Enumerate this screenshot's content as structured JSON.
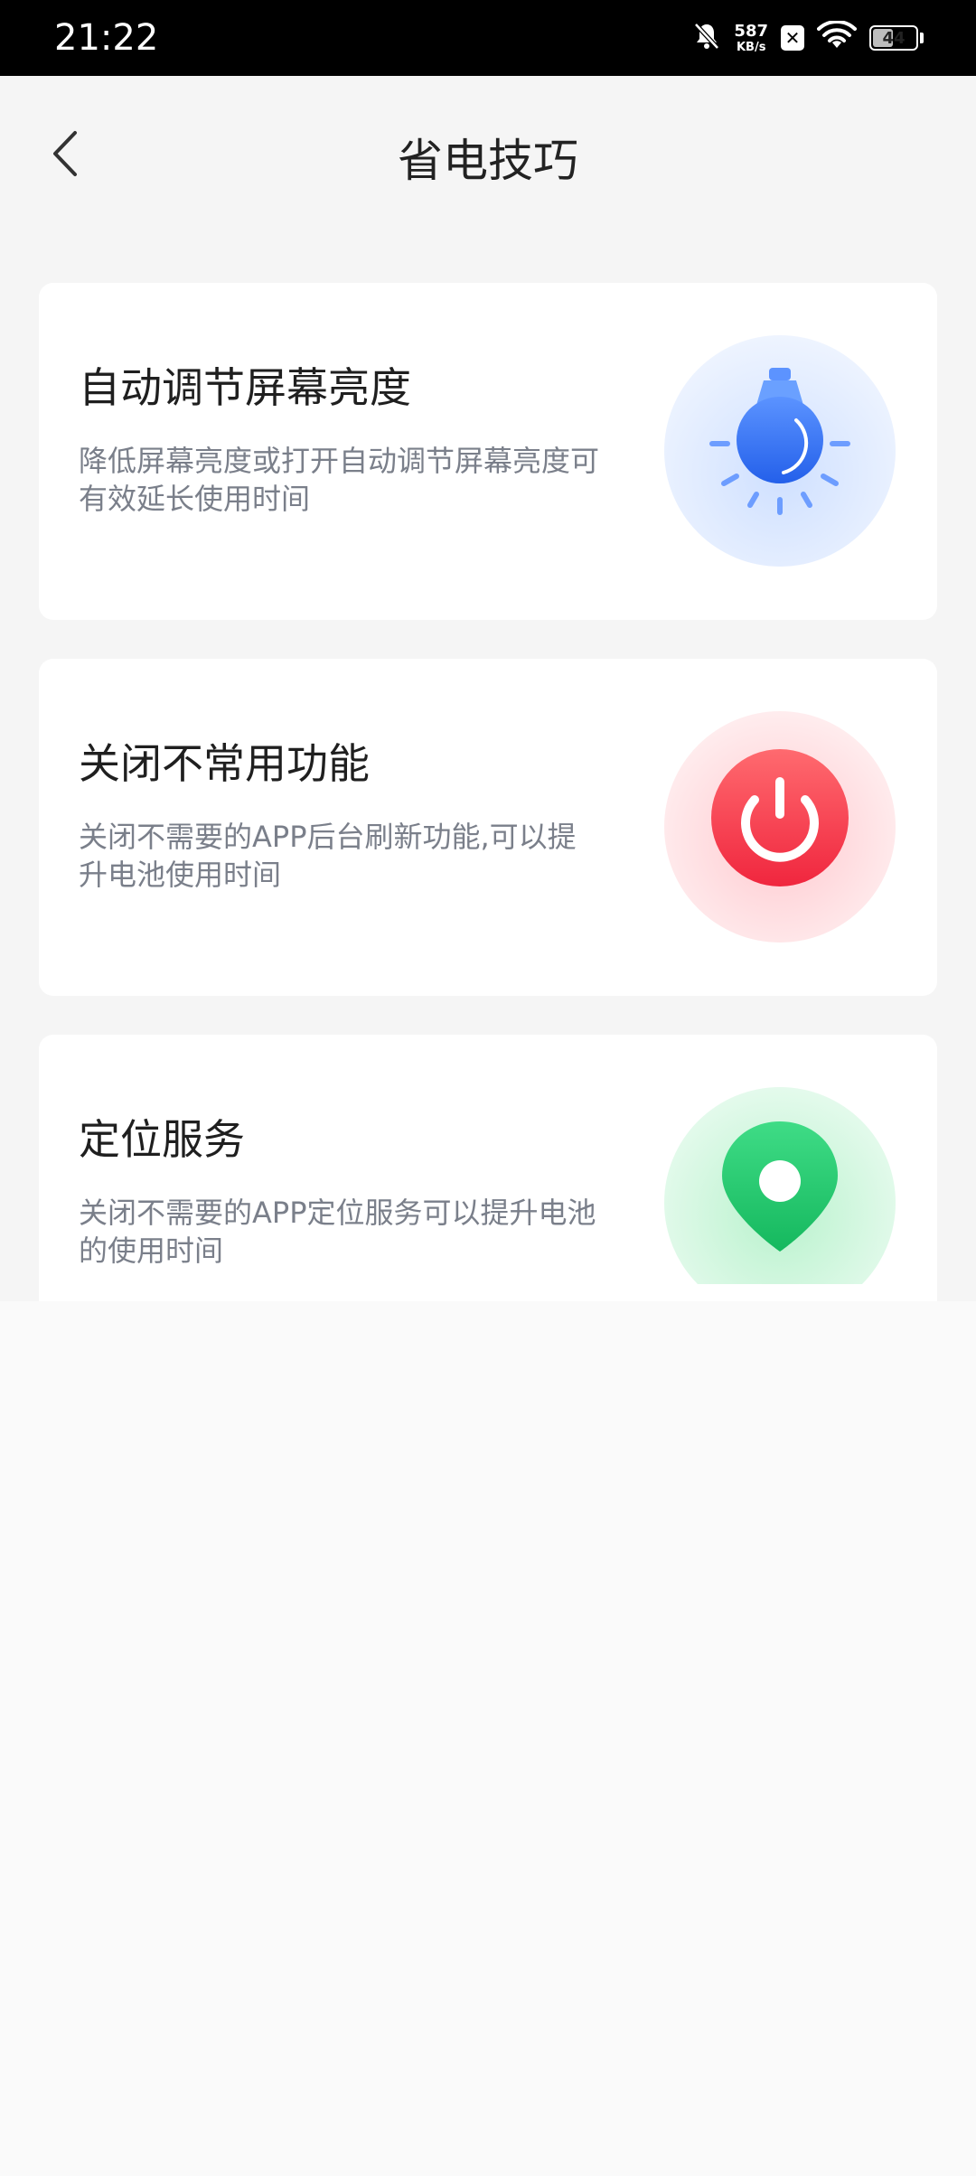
{
  "status_bar": {
    "time": "21:22",
    "net_speed_value": "587",
    "net_speed_unit": "KB/s",
    "battery_level": "44"
  },
  "header": {
    "title": "省电技巧"
  },
  "cards": [
    {
      "title": "自动调节屏幕亮度",
      "desc": "降低屏幕亮度或打开自动调节屏幕亮度可有效延长使用时间",
      "icon": "light-bulb-icon",
      "accent": "#2f6bf0"
    },
    {
      "title": "关闭不常用功能",
      "desc": "关闭不需要的APP后台刷新功能,可以提升电池使用时间",
      "icon": "power-icon",
      "accent": "#f4354b"
    },
    {
      "title": "定位服务",
      "desc": "关闭不需要的APP定位服务可以提升电池的使用时间",
      "icon": "location-pin-icon",
      "accent": "#1fc46a"
    }
  ]
}
